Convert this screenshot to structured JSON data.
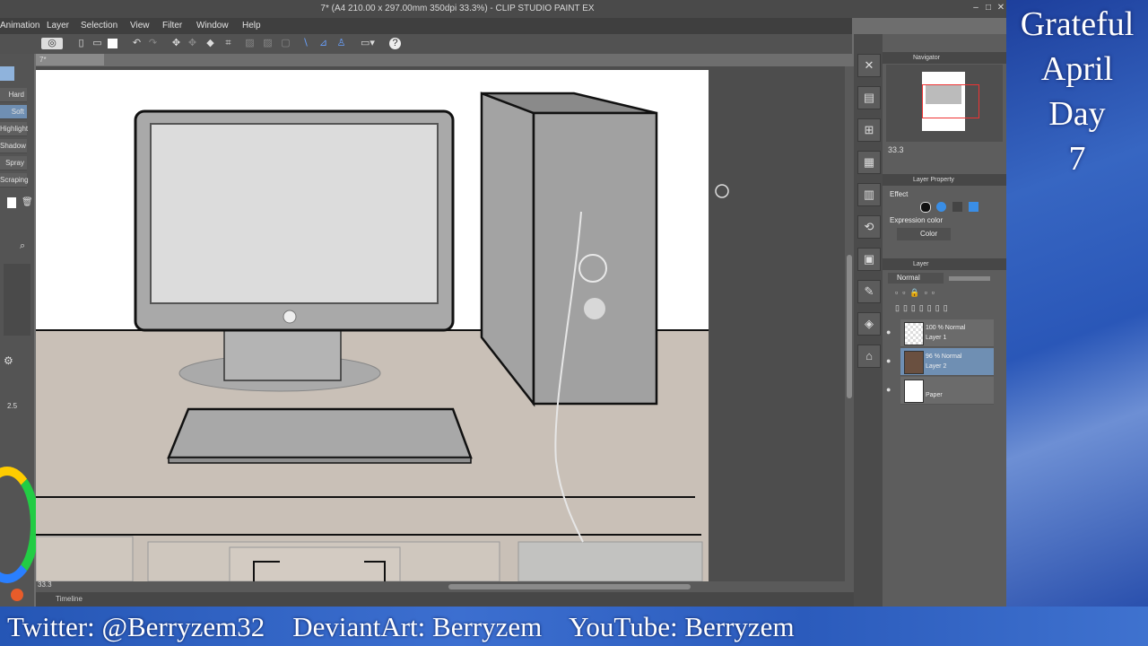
{
  "window": {
    "title": "7* (A4 210.00 x 297.00mm 350dpi 33.3%) - CLIP STUDIO PAINT EX"
  },
  "menu": [
    "Animation",
    "Layer",
    "Selection",
    "View",
    "Filter",
    "Window",
    "Help"
  ],
  "brush": {
    "items": [
      "Hard",
      "Soft",
      "Highlight",
      "Shadow",
      "Spray",
      "Scraping"
    ],
    "selected": "Soft",
    "size_value": "2.5"
  },
  "canvas": {
    "tab_label": "7*",
    "zoom": "33.3"
  },
  "statusbar": {
    "timeline": "Timeline"
  },
  "navigator": {
    "title": "Navigator",
    "zoom": "33.3"
  },
  "layer_property": {
    "title": "Layer Property",
    "effect_label": "Effect",
    "expression_label": "Expression color",
    "expression_value": "Color"
  },
  "layer_panel": {
    "tab": "Layer",
    "blend_mode": "Normal",
    "layers": [
      {
        "line1": "100 % Normal",
        "line2": "Layer 1"
      },
      {
        "line1": "96 % Normal",
        "line2": "Layer 2"
      },
      {
        "line1": "",
        "line2": "Paper"
      }
    ]
  },
  "overlay": {
    "title_lines": [
      "Grateful",
      "April",
      "Day",
      "7"
    ],
    "footer": "Twitter: @Berryzem32    DeviantArt: Berryzem    YouTube: Berryzem"
  },
  "colors": {
    "accent": "#2a57b8",
    "selected_layer": "#6f8fb3"
  }
}
